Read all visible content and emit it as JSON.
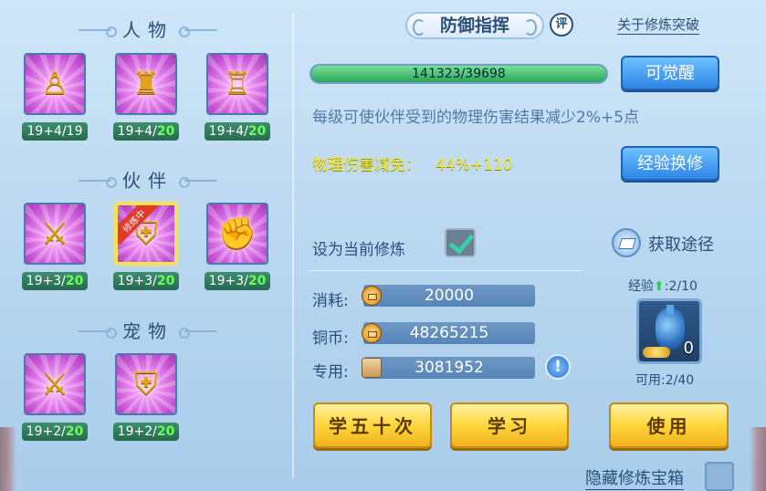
{
  "sections": {
    "character": {
      "title": "人物",
      "cards": [
        {
          "icon": "golden-statue-icon",
          "glyph": "♙",
          "base": "19+4/",
          "tail": "19"
        },
        {
          "icon": "golden-shield-warrior-icon",
          "glyph": "♜",
          "base": "19+4/",
          "tail": "20"
        },
        {
          "icon": "golden-armor-icon",
          "glyph": "♖",
          "base": "19+4/",
          "tail": "20"
        }
      ]
    },
    "partner": {
      "title": "伙伴",
      "cards": [
        {
          "icon": "golden-sword-lion-icon",
          "glyph": "⚔",
          "base": "19+3/",
          "tail": "20"
        },
        {
          "icon": "golden-shield-lion-icon",
          "glyph": "⛨",
          "base": "19+3/",
          "tail": "20",
          "badge": "修炼中",
          "selected": true
        },
        {
          "icon": "golden-gauntlet-lion-icon",
          "glyph": "✊",
          "base": "19+3/",
          "tail": "20"
        }
      ]
    },
    "pet": {
      "title": "宠物",
      "cards": [
        {
          "icon": "golden-sword-cat-icon",
          "glyph": "⚔",
          "base": "19+2/",
          "tail": "20"
        },
        {
          "icon": "golden-shield-cat-icon",
          "glyph": "⛨",
          "base": "19+2/",
          "tail": "20"
        }
      ]
    }
  },
  "header": {
    "title": "防御指挥",
    "rate": "评",
    "about": "关于修炼突破"
  },
  "progress": {
    "text": "141323/39698",
    "fill_fraction": 1.0
  },
  "buttons": {
    "awaken": "可觉醒",
    "exchange": "经验换修",
    "learn50": "学五十次",
    "learn": "学习",
    "use": "使用"
  },
  "description": "每级可使伙伴受到的物理伤害结果减少2%+5点",
  "effect": {
    "label": "物理伤害减免：",
    "value": "44%+110"
  },
  "set_current": {
    "label": "设为当前修炼",
    "checked": true
  },
  "obtain": "获取途径",
  "resources": [
    {
      "label": "消耗:",
      "value": "20000",
      "icon": "coin-icon"
    },
    {
      "label": "铜币:",
      "value": "48265215",
      "icon": "coin-icon"
    },
    {
      "label": "专用:",
      "value": "3081952",
      "icon": "scroll-icon"
    }
  ],
  "info": "!",
  "exp": {
    "label": "经验",
    "value": ":2/10",
    "item_count": "0",
    "available": "可用:2/40"
  },
  "hidden_chest": "隐藏修炼宝箱",
  "colors": {
    "effect": "#f3e43a",
    "progress_fill": "#2aa45a",
    "level_tail": "#6bff55"
  }
}
